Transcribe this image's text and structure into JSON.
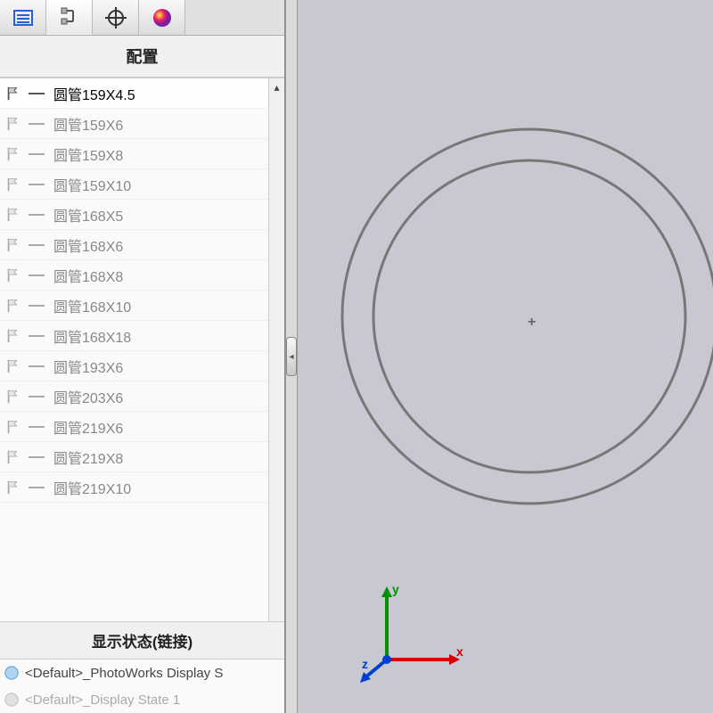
{
  "tabs": {
    "t0": "feature-tree",
    "t1": "configurations",
    "t2": "dimxpert",
    "t3": "appearance"
  },
  "sections": {
    "configs_title": "配置",
    "display_states_title": "显示状态(链接)"
  },
  "configs": [
    {
      "label": "圆管159X4.5",
      "active": true
    },
    {
      "label": "圆管159X6",
      "active": false
    },
    {
      "label": "圆管159X8",
      "active": false
    },
    {
      "label": "圆管159X10",
      "active": false
    },
    {
      "label": "圆管168X5",
      "active": false
    },
    {
      "label": "圆管168X6",
      "active": false
    },
    {
      "label": "圆管168X8",
      "active": false
    },
    {
      "label": "圆管168X10",
      "active": false
    },
    {
      "label": "圆管168X18",
      "active": false
    },
    {
      "label": "圆管193X6",
      "active": false
    },
    {
      "label": "圆管203X6",
      "active": false
    },
    {
      "label": "圆管219X6",
      "active": false
    },
    {
      "label": "圆管219X8",
      "active": false
    },
    {
      "label": "圆管219X10",
      "active": false
    }
  ],
  "display_states": [
    {
      "label": "<Default>_PhotoWorks Display S",
      "dim": false
    },
    {
      "label": "<Default>_Display State 1",
      "dim": true
    }
  ],
  "triad": {
    "x": "x",
    "y": "y",
    "z": "z"
  },
  "origin_marker": "+"
}
